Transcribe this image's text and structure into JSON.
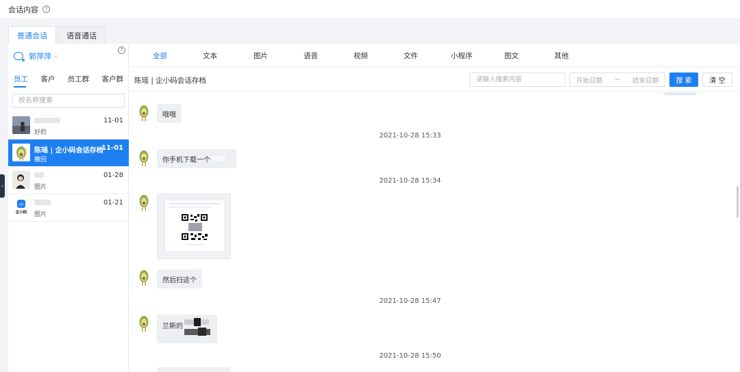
{
  "header": {
    "title": "会话内容"
  },
  "tabs": [
    {
      "label": "普通会话"
    },
    {
      "label": "语音通话"
    }
  ],
  "sidebar": {
    "user_name": "郭萍萍",
    "subtabs": [
      {
        "label": "员工"
      },
      {
        "label": "客户"
      },
      {
        "label": "员工群"
      },
      {
        "label": "客户群"
      }
    ],
    "search_placeholder": "按名称搜索",
    "contacts": [
      {
        "name": "",
        "date": "11-01",
        "last_message": "好的"
      },
      {
        "name": "陈瑶 | 企小码会话存档",
        "date": "11-01",
        "last_message": "撤回"
      },
      {
        "name": "",
        "date": "01-28",
        "last_message": "图片"
      },
      {
        "name": "",
        "date": "01-21",
        "last_message": "图片"
      }
    ],
    "brand_label": "企小码"
  },
  "type_filters": [
    {
      "label": "全部"
    },
    {
      "label": "文本"
    },
    {
      "label": "图片"
    },
    {
      "label": "语音"
    },
    {
      "label": "视频"
    },
    {
      "label": "文件"
    },
    {
      "label": "小程序"
    },
    {
      "label": "图文"
    },
    {
      "label": "其他"
    }
  ],
  "toolbar": {
    "conversation_title": "陈瑶 | 企小码会话存档",
    "search_placeholder": "请输入搜索内容",
    "start_date_placeholder": "开始日期",
    "date_separator": "~",
    "end_date_placeholder": "结束日期",
    "search_label": "搜 索",
    "clear_label": "清 空"
  },
  "messages": [
    {
      "type": "text",
      "text": "哦哦"
    },
    {
      "type": "time",
      "text": "2021-10-28 15:33"
    },
    {
      "type": "text",
      "text": "你手机下载一个"
    },
    {
      "type": "time",
      "text": "2021-10-28 15:34"
    },
    {
      "type": "image"
    },
    {
      "type": "text",
      "text": "然后扫这个"
    },
    {
      "type": "time",
      "text": "2021-10-28 15:47"
    },
    {
      "type": "text",
      "text": "兰斯的"
    },
    {
      "type": "time",
      "text": "2021-10-28 15:50"
    }
  ],
  "colors": {
    "accent": "#1e7ff0",
    "bubble": "#eeeff2",
    "background": "#f2f3f6"
  }
}
